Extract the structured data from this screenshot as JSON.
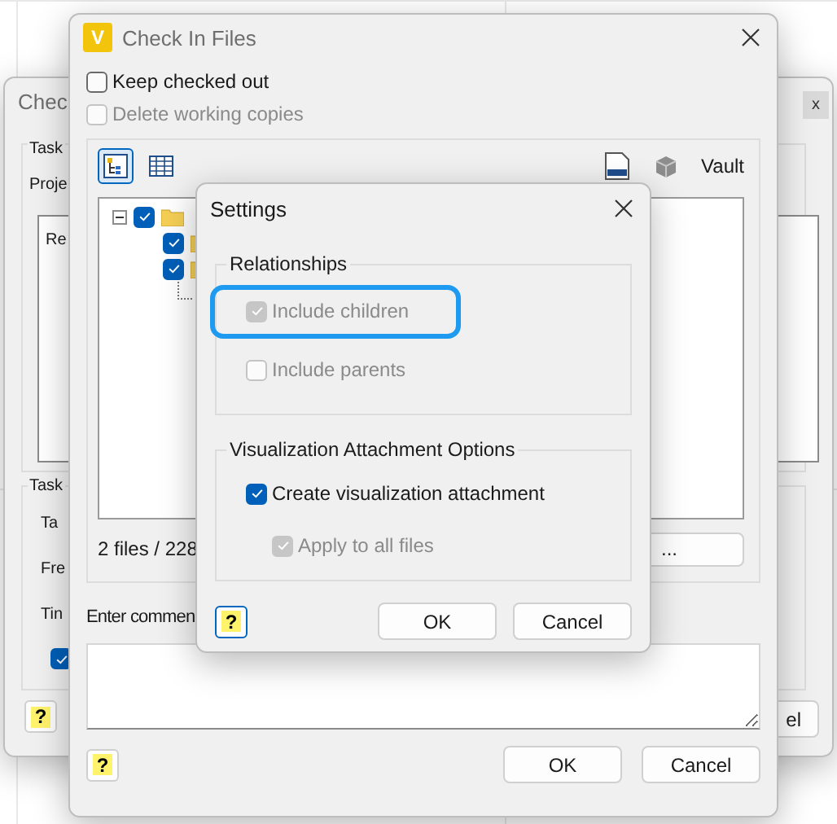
{
  "back_window": {
    "title": "Chec",
    "close": "x",
    "group_1": {
      "label": "Task",
      "field_label": "Proje",
      "list_text": "Re"
    },
    "group_2": {
      "label": "Task",
      "rows": [
        "Ta",
        "Fre",
        "Tin"
      ],
      "checkbox_checked": true
    },
    "help": "?",
    "button": "el"
  },
  "check_in_window": {
    "icon_text": "V",
    "title": "Check In Files",
    "options": [
      {
        "label": "Keep checked out",
        "checked": false,
        "disabled": false
      },
      {
        "label": "Delete working copies",
        "checked": false,
        "disabled": true
      }
    ],
    "view_buttons": [
      {
        "selected": true
      },
      {
        "selected": false
      }
    ],
    "vault_label": "Vault",
    "tree": [
      {
        "checked": true,
        "expanded": true,
        "children": [
          {
            "checked": true
          },
          {
            "checked": true,
            "expanded": true
          }
        ]
      }
    ],
    "status": "2 files / 228",
    "browse_button": "...",
    "comment": {
      "label": "Enter commen"
    },
    "help": "?",
    "buttons": [
      "OK",
      "Cancel"
    ]
  },
  "settings": {
    "title": "Settings",
    "groups": [
      {
        "label": "Relationships",
        "options": [
          {
            "label": "Include children",
            "checked": true,
            "disabled": true,
            "highlighted": true,
            "indented": false
          },
          {
            "label": "Include parents",
            "checked": false,
            "disabled": true,
            "highlighted": false,
            "indented": false
          }
        ]
      },
      {
        "label": "Visualization Attachment Options",
        "options": [
          {
            "label": "Create visualization attachment",
            "checked": true,
            "disabled": false,
            "highlighted": false,
            "indented": false
          },
          {
            "label": "Apply to all files",
            "checked": true,
            "disabled": true,
            "highlighted": false,
            "indented": true
          }
        ]
      }
    ],
    "help": "?",
    "buttons": [
      "OK",
      "Cancel"
    ]
  }
}
